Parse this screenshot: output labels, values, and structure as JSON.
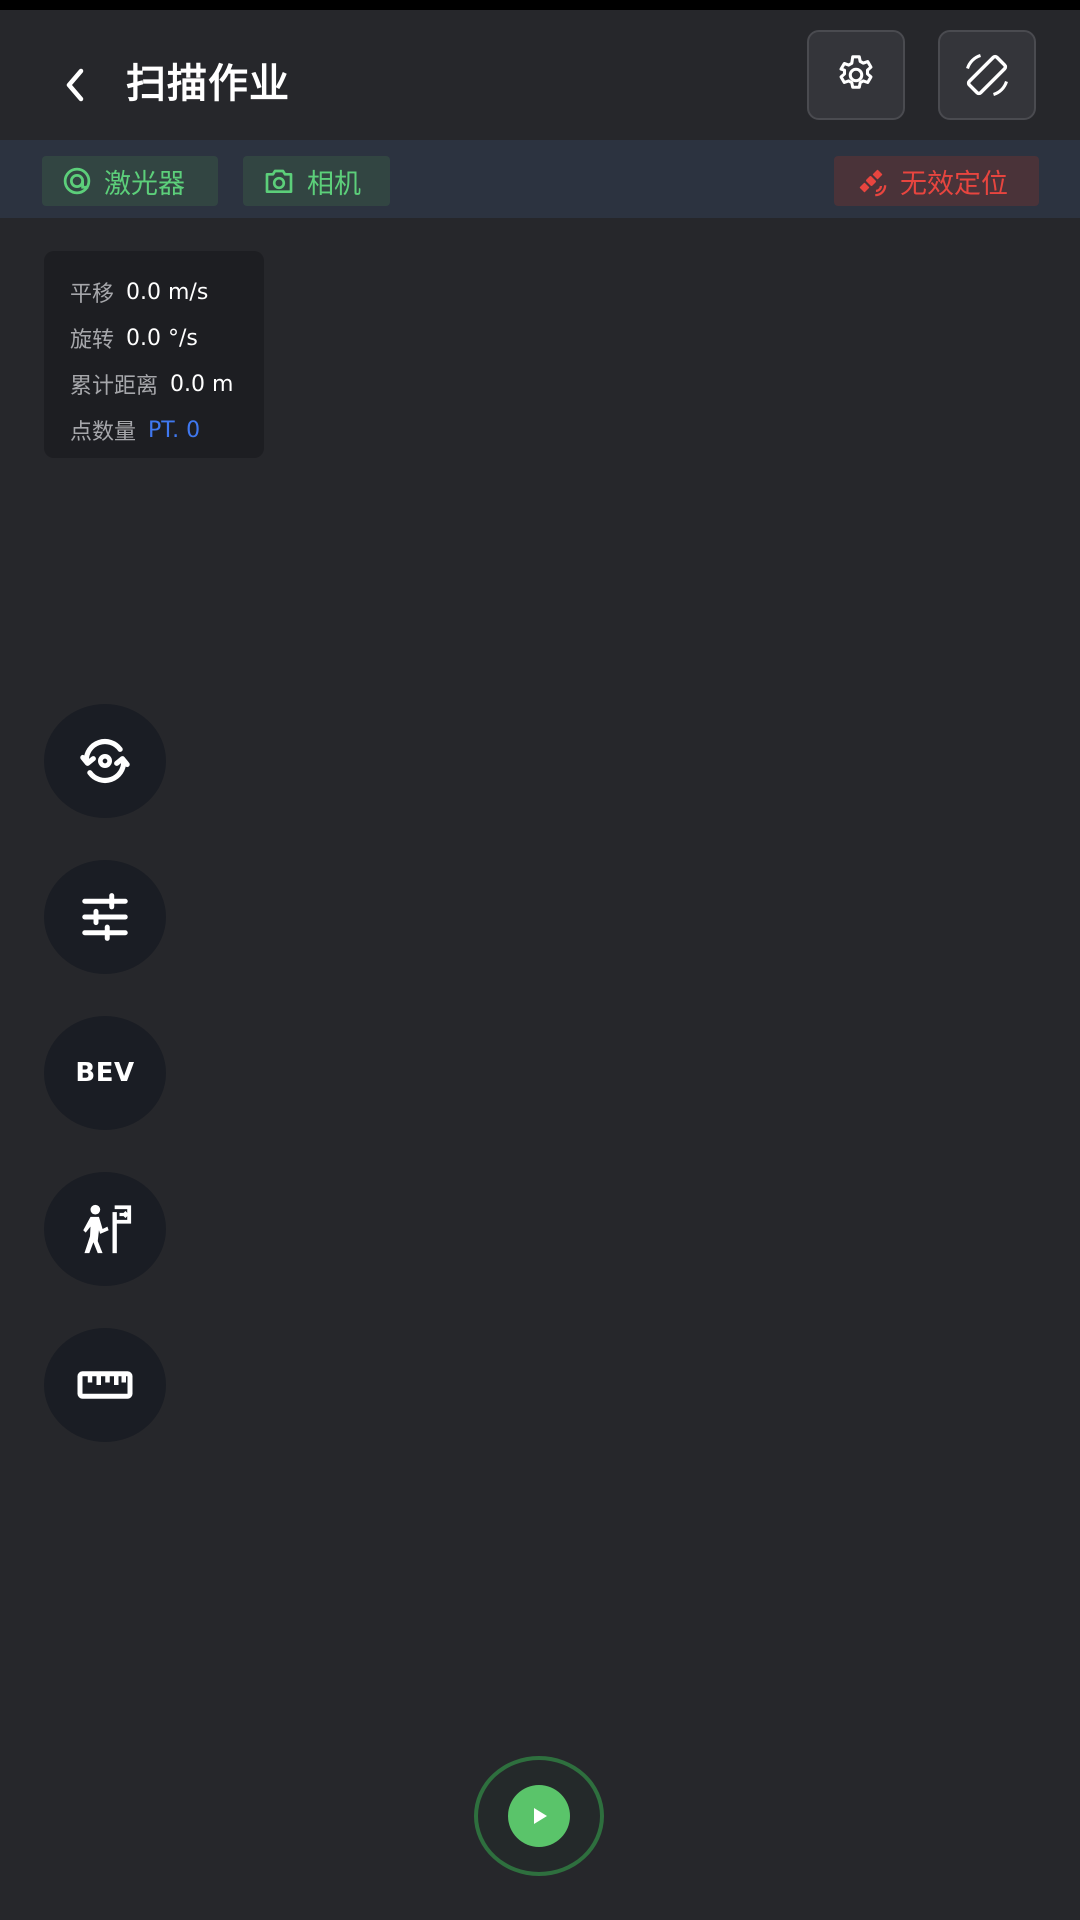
{
  "header": {
    "title": "扫描作业",
    "back_icon": "chevron-left-icon",
    "settings_icon": "gear-icon",
    "rotate_icon": "screen-rotation-icon"
  },
  "status_chips": {
    "lidar": {
      "label": "激光器",
      "icon": "lidar-icon",
      "color": "#5ccf7a"
    },
    "camera": {
      "label": "相机",
      "icon": "camera-icon",
      "color": "#5ccf7a"
    },
    "gnss": {
      "label": "无效定位",
      "icon": "satellite-icon",
      "color": "#e8453f"
    }
  },
  "info_panel": {
    "translation": {
      "label": "平移",
      "value": "0.0 m/s"
    },
    "rotation": {
      "label": "旋转",
      "value": "0.0 °/s"
    },
    "distance": {
      "label": "累计距离",
      "value": "0.0 m"
    },
    "points": {
      "label": "点数量",
      "value": "PT. 0"
    }
  },
  "side_buttons": [
    {
      "icon": "reset-view-icon"
    },
    {
      "icon": "sliders-icon"
    },
    {
      "label": "BEV"
    },
    {
      "icon": "surveyor-icon"
    },
    {
      "icon": "ruler-icon"
    }
  ],
  "play_button": {
    "icon": "play-icon",
    "accent": "#5ac46a"
  }
}
